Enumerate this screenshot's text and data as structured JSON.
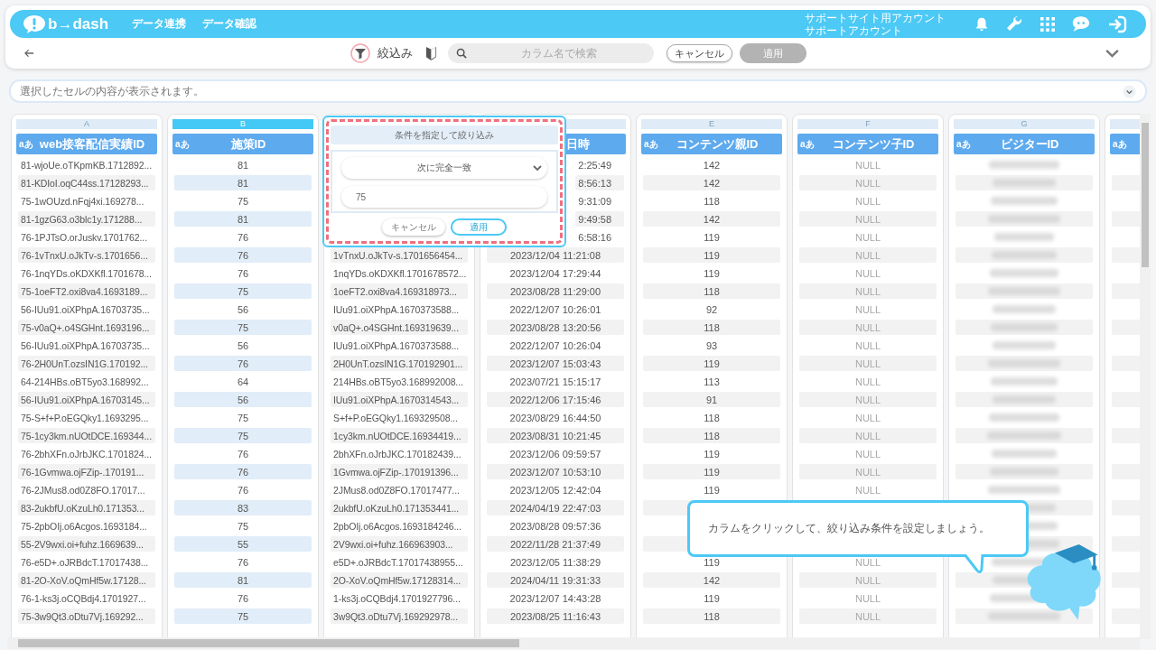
{
  "header": {
    "logo": "b→dash",
    "nav": [
      "データ連携",
      "データ確認"
    ],
    "account": [
      "サポートサイト用アカウント",
      "サポートアカウント"
    ]
  },
  "toolbar": {
    "filter_label": "絞込み",
    "search": {
      "placeholder": "カラム名で検索"
    },
    "cancel": "キャンセル",
    "apply": {
      "label": "適用",
      "disabled": true
    }
  },
  "cell_viewer": {
    "placeholder": "選択したセルの内容が表示されます。"
  },
  "columns": [
    {
      "letter": "A",
      "label": "web接客配信実績ID",
      "type_icon": "aあ",
      "selected": false,
      "left_aligned": true,
      "cells": [
        "81-wjoUe.oTKpmKB.1712892...",
        "81-KDIoI.oqC44ss.17128293...",
        "75-1wOUzd.nFqj4xi.169278...",
        "81-1gzG63.o3blc1y.171288...",
        "76-1PJTsO.orJuskv.1701762...",
        "76-1vTnxU.oJkTv-s.1701656...",
        "76-1nqYDs.oKDXKfl.1701678...",
        "75-1oeFT2.oxi8va4.1693189...",
        "56-IUu91.oiXPhpA.16703735...",
        "75-v0aQ+.o4SGHnt.1693196...",
        "56-IUu91.oiXPhpA.16703735...",
        "76-2H0UnT.ozsIN1G.170192...",
        "64-214HBs.oBT5yo3.168992...",
        "56-IUu91.oiXPhpA.16703145...",
        "75-S+f+P.oEGQky1.1693295...",
        "75-1cy3km.nUOtDCE.169344...",
        "76-2bhXFn.oJrbJKC.1701824...",
        "76-1Gvmwa.ojFZip-.170191...",
        "76-2JMus8.od0Z8FO.17017...",
        "83-2ukbfU.oKzuLh0.171353...",
        "75-2pbOIj.o6Acgos.1693184...",
        "55-2V9wxi.oi+fuhz.1669639...",
        "76-e5D+.oJRBdcT.17017438...",
        "81-2O-XoV.oQmHf5w.17128...",
        "76-1-ks3j.oCQBdj4.1701927...",
        "75-3w9Qt3.oDtu7Vj.169292..."
      ]
    },
    {
      "letter": "B",
      "label": "施策ID",
      "type_icon": "aあ",
      "selected": true,
      "cells": [
        "81",
        "81",
        "75",
        "81",
        "76",
        "76",
        "76",
        "75",
        "56",
        "75",
        "56",
        "76",
        "64",
        "56",
        "75",
        "75",
        "76",
        "76",
        "76",
        "83",
        "75",
        "55",
        "76",
        "81",
        "76",
        "75"
      ]
    },
    {
      "left_aligned": true,
      "cells": [
        null,
        null,
        null,
        null,
        null,
        "1vTnxU.oJkTv-s.1701656454...",
        "1nqYDs.oKDXKfl.1701678572...",
        "1oeFT2.oxi8va4.169318973...",
        "IUu91.oiXPhpA.1670373588...",
        "v0aQ+.o4SGHnt.169319639...",
        "IUu91.oiXPhpA.1670373588...",
        "2H0UnT.ozsIN1G.170192901...",
        "214HBs.oBT5yo3.168992008...",
        "IUu91.oiXPhpA.1670314543...",
        "S+f+P.oEGQky1.169329508...",
        "1cy3km.nUOtDCE.16934419...",
        "2bhXFn.oJrbJKC.170182439...",
        "1Gvmwa.ojFZip-.170191396...",
        "2JMus8.od0Z8FO.17017477...",
        "2ukbfU.oKzuLh0.171353441...",
        "2pbOIj.o6Acgos.1693184246...",
        "2V9wxi.oi+fuhz.166963903...",
        "e5D+.oJRBdcT.17017438955...",
        "2O-XoV.oQmHf5w.17128314...",
        "1-ks3j.oCQBdj4.1701927796...",
        "3w9Qt3.oDtu7Vj.169292978..."
      ]
    },
    {
      "label": "日時",
      "label_cut": true,
      "selected": false,
      "cells": [
        {
          "text": "2:25:49",
          "cut": true
        },
        {
          "text": "8:56:13",
          "cut": true
        },
        {
          "text": "9:31:09",
          "cut": true
        },
        {
          "text": "9:49:58",
          "cut": true
        },
        {
          "text": "6:58:16",
          "cut": true
        },
        "2023/12/04 11:21:08",
        "2023/12/04 17:29:44",
        "2023/08/28 11:29:00",
        "2022/12/07 10:26:01",
        "2023/08/28 13:20:56",
        "2022/12/07 10:26:04",
        "2023/12/07 15:03:43",
        "2023/07/21 15:15:17",
        "2022/12/06 17:15:46",
        "2023/08/29 16:44:50",
        "2023/08/31 10:21:45",
        "2023/12/06 09:59:57",
        "2023/12/07 10:53:10",
        "2023/12/05 12:42:04",
        "2024/04/19 22:47:03",
        "2023/08/28 09:57:36",
        "2022/11/28 21:37:49",
        "2023/12/05 11:38:29",
        "2024/04/11 19:31:33",
        "2023/12/07 14:43:28",
        "2023/08/25 11:16:43"
      ]
    },
    {
      "letter": "E",
      "label": "コンテンツ親ID",
      "type_icon": "aあ",
      "selected": false,
      "cells": [
        "142",
        "142",
        "118",
        "142",
        "119",
        "119",
        "119",
        "118",
        "92",
        "118",
        "93",
        "119",
        "113",
        "91",
        "118",
        "118",
        "119",
        "119",
        "119",
        null,
        null,
        null,
        "119",
        "142",
        "119",
        "118"
      ]
    },
    {
      "letter": "F",
      "label": "コンテンツ子ID",
      "type_icon": "aあ",
      "selected": false,
      "null_style": true,
      "cells": [
        "NULL",
        "NULL",
        "NULL",
        "NULL",
        "NULL",
        "NULL",
        "NULL",
        "NULL",
        "NULL",
        "NULL",
        "NULL",
        "NULL",
        "NULL",
        "NULL",
        "NULL",
        "NULL",
        "NULL",
        "NULL",
        "NULL",
        null,
        null,
        null,
        "NULL",
        "NULL",
        "NULL",
        "NULL"
      ]
    },
    {
      "letter": "G",
      "label": "ビジターID",
      "type_icon": "aあ",
      "selected": false,
      "blurred": true
    },
    {
      "type_icon": "aあ",
      "selected": false,
      "narrow": true
    }
  ],
  "filter_popup": {
    "title": "条件を指定して絞り込み",
    "condition": "次に完全一致",
    "value": "75",
    "cancel": "キャンセル",
    "apply": "適用"
  },
  "hint": {
    "text": "カラムをクリックして、絞り込み条件を設定しましょう。"
  }
}
